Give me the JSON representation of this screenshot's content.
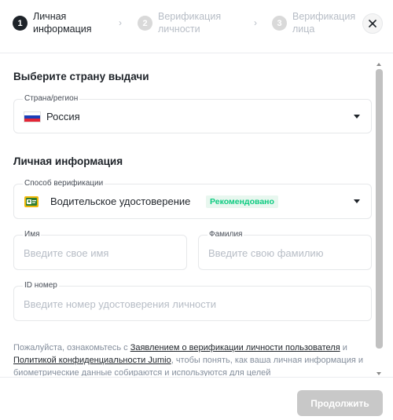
{
  "stepper": {
    "steps": [
      {
        "number": "1",
        "label": "Личная\nинформация",
        "state": "active"
      },
      {
        "number": "2",
        "label": "Верификация\nличности",
        "state": "inactive"
      },
      {
        "number": "3",
        "label": "Верификация\nлица",
        "state": "inactive"
      }
    ],
    "chevron": "›",
    "close_icon": "close-icon"
  },
  "country_section": {
    "title": "Выберите страну выдачи",
    "field_label": "Страна/регион",
    "value": "Россия",
    "flag_icon": "russia-flag-icon"
  },
  "personal_section": {
    "title": "Личная информация",
    "verification_method": {
      "label": "Способ верификации",
      "value": "Водительское удостоверение",
      "badge": "Рекомендовано",
      "icon": "drivers-license-icon"
    },
    "first_name": {
      "label": "Имя",
      "placeholder": "Введите свое имя"
    },
    "last_name": {
      "label": "Фамилия",
      "placeholder": "Введите свою фамилию"
    },
    "id_number": {
      "label": "ID номер",
      "placeholder": "Введите номер удостоверения личности"
    }
  },
  "notice": {
    "prefix": "Пожалуйста, ознакомьтесь с ",
    "link1": "Заявлением о верификации личности пользователя",
    "middle": " и ",
    "link2": "Политикой конфиденциальности Jumio",
    "suffix": ", чтобы понять, как ваша личная информация и биометрические данные собираются и используются для целей"
  },
  "footer": {
    "continue_label": "Продолжить"
  },
  "colors": {
    "primary_text": "#1e2329",
    "muted_text": "#b7bdc6",
    "badge_green": "#0ecb81",
    "disabled_button": "#c8c8c8"
  }
}
